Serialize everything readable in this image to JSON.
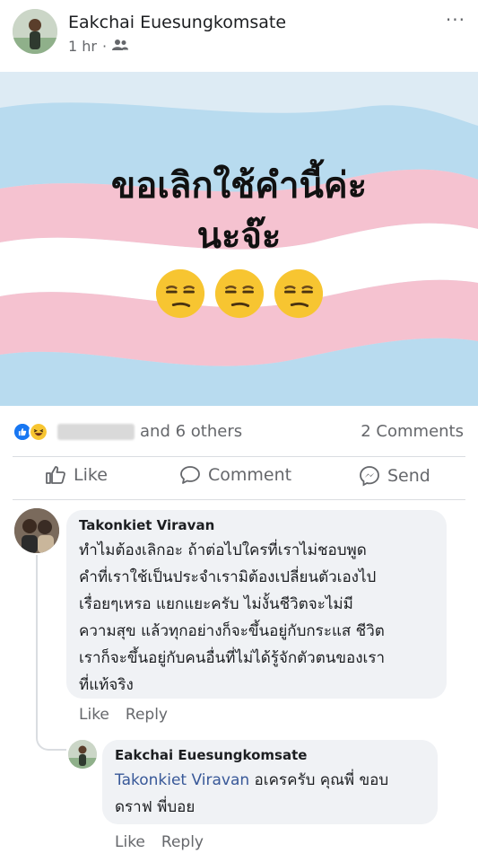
{
  "post": {
    "author": "Eakchai Euesungkomsate",
    "time": "1 hr",
    "separator": "·",
    "audience_icon": "friends-icon",
    "more_label": "···"
  },
  "image": {
    "line1": "ขอเลิกใช้คำนี้ค่ะ",
    "line2": "นะจ๊ะ",
    "emoji": "unamused-face",
    "colors": {
      "blue": "#a9d3ec",
      "pink": "#f3b5c6",
      "white": "#ffffff"
    }
  },
  "reactions": {
    "icons": [
      "like",
      "haha"
    ],
    "others": "and 6 others",
    "comments": "2 Comments"
  },
  "actions": {
    "like": "Like",
    "comment": "Comment",
    "send": "Send"
  },
  "comments": [
    {
      "author": "Takonkiet Viravan",
      "lines": [
        "ทำไมต้องเลิกอะ ถ้าต่อไปใครที่เราไม่ชอบพูด",
        "คำที่เราใช้เป็นประจำเรามิต้องเปลี่ยนตัวเองไป",
        "เรื่อยๆเหรอ แยกแยะครับ ไม่งั้นชีวิตจะไม่มี",
        "ความสุข แล้วทุกอย่างก็จะขึ้นอยู่กับกระแส ชีวิต",
        "เราก็จะขึ้นอยู่กับคนอื่นที่ไม่ได้รู้จักตัวตนของเรา",
        "ที่แท้จริง"
      ],
      "like": "Like",
      "reply": "Reply"
    },
    {
      "author": "Eakchai Euesungkomsate",
      "mention": "Takonkiet Viravan",
      "line1_rest": " อเครครับ คุณพี่ ขอบ",
      "line2": "ดราฟ พี่บอย",
      "like": "Like",
      "reply": "Reply"
    }
  ]
}
